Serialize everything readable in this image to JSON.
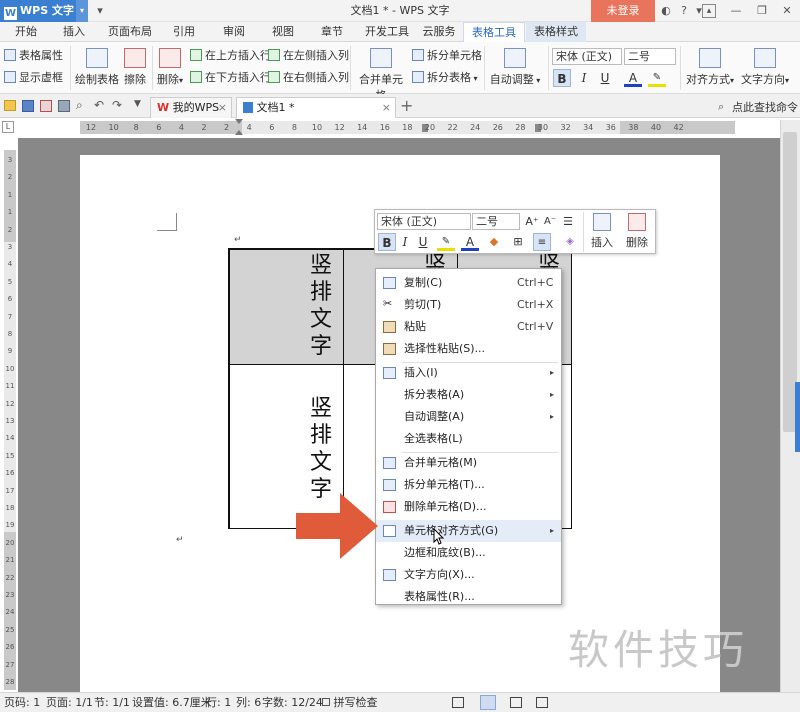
{
  "titlebar": {
    "app_name": "WPS 文字",
    "document_title": "文档1 * - WPS 文字",
    "login_button": "未登录",
    "icons": [
      "skin-icon",
      "help-icon",
      "minimize-ribbon-icon",
      "minimize-icon",
      "restore-icon",
      "close-icon"
    ]
  },
  "menubar": {
    "tabs": [
      "开始",
      "插入",
      "页面布局",
      "引用",
      "审阅",
      "视图",
      "章节",
      "开发工具",
      "云服务",
      "表格工具",
      "表格样式"
    ],
    "active_tab": "表格工具"
  },
  "ribbon": {
    "table_properties": "表格属性",
    "show_gridlines": "显示虚框",
    "draw_table": "绘制表格",
    "eraser": "擦除",
    "delete": "删除",
    "insert_above": "在上方插入行",
    "insert_below": "在下方插入行",
    "insert_left": "在左侧插入列",
    "insert_right": "在右侧插入列",
    "merge_cells": "合并单元格",
    "split_cells": "拆分单元格",
    "split_table": "拆分表格",
    "auto_fit": "自动调整",
    "font_name": "宋体 (正文)",
    "font_size": "二号",
    "alignment": "对齐方式",
    "text_direction": "文字方向"
  },
  "quick_access": {
    "tabs": [
      {
        "label": "我的WPS"
      },
      {
        "label": "文档1 *"
      }
    ],
    "search_hint": "点此查找命令"
  },
  "ruler": {
    "h_numbers": [
      "12",
      "10",
      "8",
      "6",
      "4",
      "2",
      "2",
      "4",
      "6",
      "8",
      "10",
      "12",
      "14",
      "16",
      "18",
      "20",
      "22",
      "24",
      "26",
      "28",
      "30",
      "32",
      "34",
      "36",
      "38",
      "40",
      "42"
    ],
    "v_numbers": [
      "3",
      "2",
      "1",
      "1",
      "2",
      "3",
      "4",
      "5",
      "6",
      "7",
      "8",
      "9",
      "10",
      "11",
      "12",
      "13",
      "14",
      "15",
      "16",
      "17",
      "18",
      "19",
      "20",
      "21",
      "22",
      "23",
      "24",
      "25",
      "26",
      "27",
      "28"
    ]
  },
  "document": {
    "cell_top_left": "竖排文字",
    "cell_top_mid": "竖",
    "cell_top_right": "竖",
    "cell_bottom_left": "竖排文字"
  },
  "mini_toolbar": {
    "font_name": "宋体 (正文)",
    "font_size": "二号",
    "insert": "插入",
    "delete": "删除"
  },
  "context_menu": {
    "items": [
      {
        "label": "复制(C)",
        "shortcut": "Ctrl+C"
      },
      {
        "label": "剪切(T)",
        "shortcut": "Ctrl+X"
      },
      {
        "label": "粘贴",
        "shortcut": "Ctrl+V"
      },
      {
        "label": "选择性粘贴(S)..."
      },
      {
        "label": "插入(I)"
      },
      {
        "label": "拆分表格(A)"
      },
      {
        "label": "自动调整(A)"
      },
      {
        "label": "全选表格(L)"
      },
      {
        "label": "合并单元格(M)"
      },
      {
        "label": "拆分单元格(T)..."
      },
      {
        "label": "删除单元格(D)..."
      },
      {
        "label": "单元格对齐方式(G)"
      },
      {
        "label": "边框和底纹(B)..."
      },
      {
        "label": "文字方向(X)..."
      },
      {
        "label": "表格属性(R)..."
      }
    ]
  },
  "statusbar": {
    "page_code": "页码: 1",
    "page": "页面: 1/1",
    "section": "节: 1/1",
    "setting": "设置值: 6.7厘米",
    "row": "行: 1",
    "col": "列: 6",
    "words": "字数: 12/24",
    "spell": "拼写检查"
  },
  "watermark": "软件技巧",
  "colors": {
    "accent": "#3a7fd0",
    "login": "#e8745c",
    "arrow": "#e05b3a",
    "canvas": "#888888"
  }
}
